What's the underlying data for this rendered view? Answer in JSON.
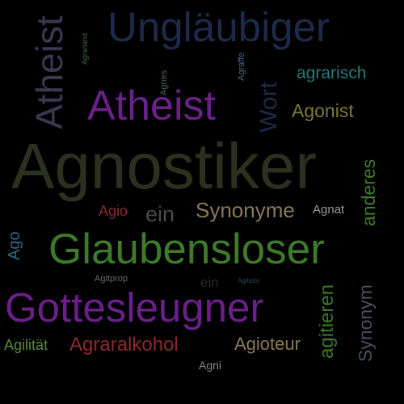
{
  "colors": {
    "background": "#000000",
    "navy": "#1e2a4a",
    "purple": "#6a1f8a",
    "dark_olive": "#2c311f",
    "olive": "#7a7a3a",
    "green": "#3d7a2a",
    "teal": "#2a7a7a",
    "red": "#8a2a2a",
    "tan": "#8a7a5a",
    "grey": "#4a4a4a"
  },
  "words": [
    {
      "key": "unglaeubiger",
      "text": "Ungläubiger"
    },
    {
      "key": "atheist_vertical",
      "text": "Atheist"
    },
    {
      "key": "agrarland",
      "text": "Agrarland"
    },
    {
      "key": "agnes",
      "text": "Agnes"
    },
    {
      "key": "agraffe",
      "text": "Agraffe"
    },
    {
      "key": "agrarisch",
      "text": "agrarisch"
    },
    {
      "key": "atheist",
      "text": "Atheist"
    },
    {
      "key": "wort",
      "text": "Wort"
    },
    {
      "key": "agonist",
      "text": "Agonist"
    },
    {
      "key": "agnostiker",
      "text": "Agnostiker"
    },
    {
      "key": "anderes",
      "text": "anderes"
    },
    {
      "key": "agio",
      "text": "Agio"
    },
    {
      "key": "ein",
      "text": "ein"
    },
    {
      "key": "synonyme",
      "text": "Synonyme"
    },
    {
      "key": "agnat",
      "text": "Agnat"
    },
    {
      "key": "ago",
      "text": "Ago"
    },
    {
      "key": "glaubensloser",
      "text": "Glaubensloser"
    },
    {
      "key": "agitprop",
      "text": "Agitprop"
    },
    {
      "key": "ein_small",
      "text": "ein"
    },
    {
      "key": "agitator",
      "text": "Agitator"
    },
    {
      "key": "agitieren",
      "text": "agitieren"
    },
    {
      "key": "synonym",
      "text": "Synonym"
    },
    {
      "key": "gottesleugner",
      "text": "Gottesleugner"
    },
    {
      "key": "agilitaet",
      "text": "Agilität"
    },
    {
      "key": "agraralkohol",
      "text": "Agraralkohol"
    },
    {
      "key": "agioteur",
      "text": "Agioteur"
    },
    {
      "key": "agni",
      "text": "Agni"
    }
  ]
}
